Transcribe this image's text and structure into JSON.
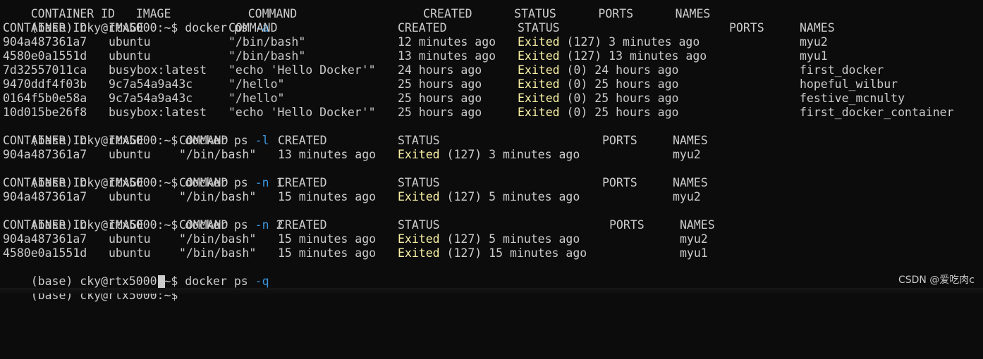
{
  "prompt": "(base) cky@rtx5000:~$ ",
  "partial_top_header": "CONTAINER ID   IMAGE           COMMAND                  CREATED      STATUS      PORTS      NAMES",
  "commands": [
    {
      "cmd": "docker ps ",
      "flag": "-a"
    },
    {
      "cmd": "docker ps ",
      "flag": "-l"
    },
    {
      "cmd": "docker ps ",
      "flag": "-n",
      "arg": " 1"
    },
    {
      "cmd": "docker ps ",
      "flag": "-n",
      "arg": " 2"
    },
    {
      "cmd": "docker ps ",
      "flag": "-q"
    }
  ],
  "headers": {
    "container_id": "CONTAINER ID",
    "image": "IMAGE",
    "command": "COMMAND",
    "created": "CREATED",
    "status": "STATUS",
    "ports": "PORTS",
    "names": "NAMES"
  },
  "status_word": "Exited",
  "table_a": [
    {
      "id": "904a487361a7",
      "image": "ubuntu",
      "command": "\"/bin/bash\"",
      "created": "12 minutes ago",
      "status_rest": " (127) 3 minutes ago",
      "name": "myu2"
    },
    {
      "id": "4580e0a1551d",
      "image": "ubuntu",
      "command": "\"/bin/bash\"",
      "created": "13 minutes ago",
      "status_rest": " (127) 13 minutes ago",
      "name": "myu1"
    },
    {
      "id": "7d32557011ca",
      "image": "busybox:latest",
      "command": "\"echo 'Hello Docker'\"",
      "created": "24 hours ago",
      "status_rest": " (0) 24 hours ago",
      "name": "first_docker"
    },
    {
      "id": "9470ddf4f03b",
      "image": "9c7a54a9a43c",
      "command": "\"/hello\"",
      "created": "25 hours ago",
      "status_rest": " (0) 25 hours ago",
      "name": "hopeful_wilbur"
    },
    {
      "id": "0164f5b0e58a",
      "image": "9c7a54a9a43c",
      "command": "\"/hello\"",
      "created": "25 hours ago",
      "status_rest": " (0) 25 hours ago",
      "name": "festive_mcnulty"
    },
    {
      "id": "10d015be26f8",
      "image": "busybox:latest",
      "command": "\"echo 'Hello Docker'\"",
      "created": "25 hours ago",
      "status_rest": " (0) 25 hours ago",
      "name": "first_docker_container"
    }
  ],
  "table_l": [
    {
      "id": "904a487361a7",
      "image": "ubuntu",
      "command": "\"/bin/bash\"",
      "created": "13 minutes ago",
      "status_rest": " (127) 3 minutes ago",
      "name": "myu2"
    }
  ],
  "table_n1": [
    {
      "id": "904a487361a7",
      "image": "ubuntu",
      "command": "\"/bin/bash\"",
      "created": "15 minutes ago",
      "status_rest": " (127) 5 minutes ago",
      "name": "myu2"
    }
  ],
  "table_n2": [
    {
      "id": "904a487361a7",
      "image": "ubuntu",
      "command": "\"/bin/bash\"",
      "created": "15 minutes ago",
      "status_rest": " (127) 5 minutes ago",
      "name": "myu2"
    },
    {
      "id": "4580e0a1551d",
      "image": "ubuntu",
      "command": "\"/bin/bash\"",
      "created": "15 minutes ago",
      "status_rest": " (127) 15 minutes ago",
      "name": "myu1"
    }
  ],
  "watermark": "CSDN @爱吃肉c",
  "colors": {
    "background": "#0c0c0c",
    "text": "#cccccc",
    "flag": "#3a96dd",
    "exited": "#f9f1a5"
  }
}
